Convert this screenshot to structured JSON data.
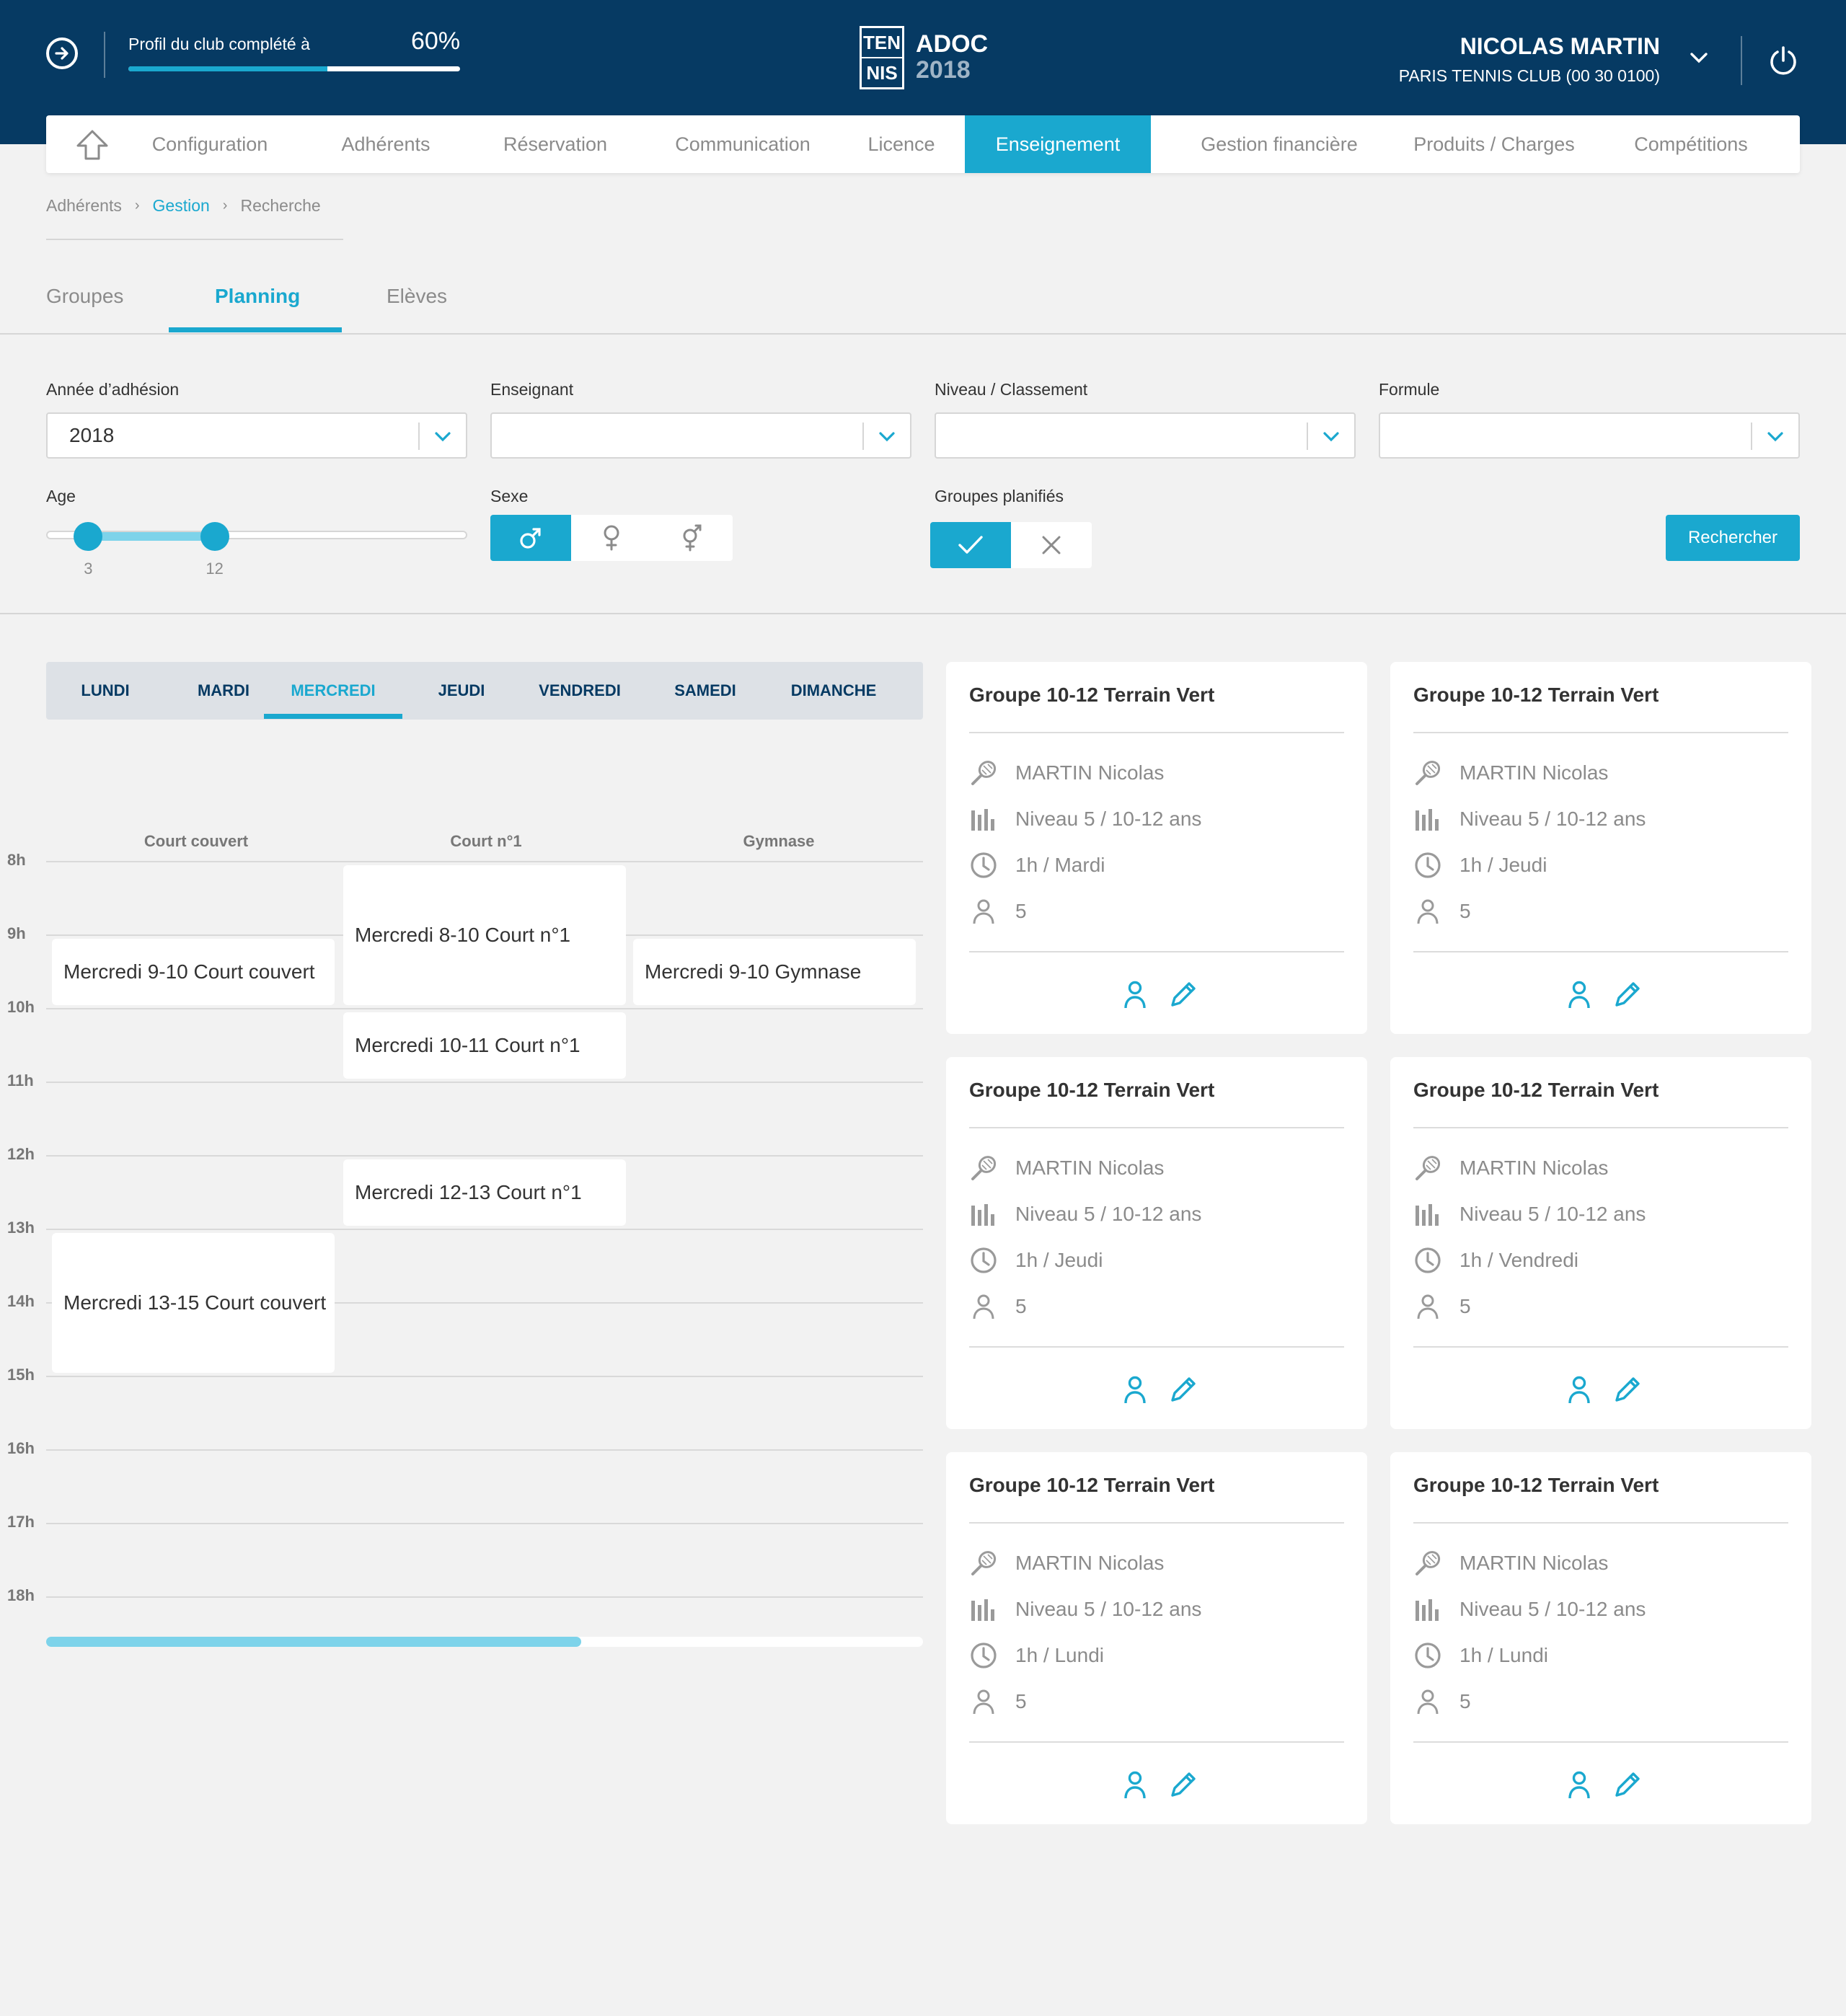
{
  "header": {
    "profile_label": "Profil du club complété à",
    "profile_percent_text": "60%",
    "profile_progress": 0.6,
    "logo_top": "TEN",
    "logo_bottom": "NIS",
    "app_name": "ADOC",
    "app_year": "2018",
    "user_name": "NICOLAS MARTIN",
    "club": "PARIS TENNIS CLUB (00 30 0100)"
  },
  "nav": {
    "items": [
      "Configuration",
      "Adhérents",
      "Réservation",
      "Communication",
      "Licence",
      "Enseignement",
      "Gestion financière",
      "Produits / Charges",
      "Compétitions"
    ],
    "active": "Enseignement"
  },
  "breadcrumb": [
    "Adhérents",
    "Gestion",
    "Recherche"
  ],
  "tabs": {
    "items": [
      "Groupes",
      "Planning",
      "Elèves"
    ],
    "active": "Planning"
  },
  "filters": {
    "annee_label": "Année d’adhésion",
    "annee_value": "2018",
    "enseignant_label": "Enseignant",
    "enseignant_value": "",
    "niveau_label": "Niveau / Classement",
    "niveau_value": "",
    "formule_label": "Formule",
    "formule_value": "",
    "age_label": "Age",
    "age_min": "3",
    "age_max": "12",
    "age_range_min": 0,
    "age_range_max": 30,
    "sexe_label": "Sexe",
    "sexe_options": [
      "male",
      "female",
      "mixed"
    ],
    "sexe_selected": "male",
    "groupes_label": "Groupes planifiés",
    "groupes_selected": "yes",
    "search_button": "Rechercher"
  },
  "days": {
    "items": [
      "LUNDI",
      "MARDI",
      "MERCREDI",
      "JEUDI",
      "VENDREDI",
      "SAMEDI",
      "DIMANCHE"
    ],
    "active": "MERCREDI"
  },
  "schedule": {
    "columns": [
      "Court couvert",
      "Court n°1",
      "Gymnase"
    ],
    "hours": [
      "8h",
      "9h",
      "10h",
      "11h",
      "12h",
      "13h",
      "14h",
      "15h",
      "16h",
      "17h",
      "18h"
    ],
    "events": [
      {
        "label": "Mercredi 9-10 Court couvert",
        "column": 0,
        "start": 9,
        "end": 10
      },
      {
        "label": "Mercredi 8-10 Court n°1",
        "column": 1,
        "start": 8,
        "end": 10
      },
      {
        "label": "Mercredi 9-10 Gymnase",
        "column": 2,
        "start": 9,
        "end": 10
      },
      {
        "label": "Mercredi 10-11 Court n°1",
        "column": 1,
        "start": 10,
        "end": 11
      },
      {
        "label": "Mercredi 12-13 Court n°1",
        "column": 1,
        "start": 12,
        "end": 13
      },
      {
        "label": "Mercredi 13-15 Court couvert",
        "column": 0,
        "start": 13,
        "end": 15
      }
    ],
    "scroll_progress": 0.61
  },
  "groups": [
    {
      "title": "Groupe 10-12 Terrain Vert",
      "teacher": "MARTIN Nicolas",
      "level": "Niveau 5 / 10-12 ans",
      "schedule": "1h / Mardi",
      "count": "5"
    },
    {
      "title": "Groupe 10-12 Terrain Vert",
      "teacher": "MARTIN Nicolas",
      "level": "Niveau 5 / 10-12 ans",
      "schedule": "1h / Jeudi",
      "count": "5"
    },
    {
      "title": "Groupe 10-12 Terrain Vert",
      "teacher": "MARTIN Nicolas",
      "level": "Niveau 5 / 10-12 ans",
      "schedule": "1h / Jeudi",
      "count": "5"
    },
    {
      "title": "Groupe 10-12 Terrain Vert",
      "teacher": "MARTIN Nicolas",
      "level": "Niveau 5 / 10-12 ans",
      "schedule": "1h / Vendredi",
      "count": "5"
    },
    {
      "title": "Groupe 10-12 Terrain Vert",
      "teacher": "MARTIN Nicolas",
      "level": "Niveau 5 / 10-12 ans",
      "schedule": "1h / Lundi",
      "count": "5"
    },
    {
      "title": "Groupe 10-12 Terrain Vert",
      "teacher": "MARTIN Nicolas",
      "level": "Niveau 5 / 10-12 ans",
      "schedule": "1h / Lundi",
      "count": "5"
    }
  ],
  "colors": {
    "navy": "#063a63",
    "accent": "#1aa8cf",
    "background": "#f2f2f2"
  }
}
